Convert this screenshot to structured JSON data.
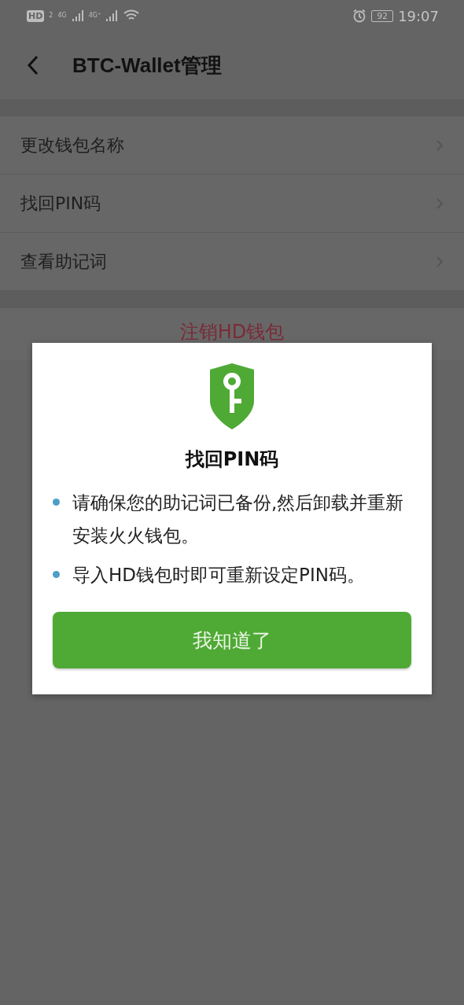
{
  "status_bar": {
    "hd": "HD",
    "sim": "2",
    "net_1": "4G",
    "net_2": "4G⁺",
    "battery": "92",
    "time": "19:07"
  },
  "header": {
    "title": "BTC-Wallet管理"
  },
  "menu_items": [
    {
      "label": "更改钱包名称"
    },
    {
      "label": "找回PIN码"
    },
    {
      "label": "查看助记词"
    }
  ],
  "logout_button": "注销HD钱包",
  "dialog": {
    "title": "找回PIN码",
    "bullets": [
      "请确保您的助记词已备份,然后卸载并重新安装火火钱包。",
      "导入HD钱包时即可重新设定PIN码。"
    ],
    "button": "我知道了"
  }
}
